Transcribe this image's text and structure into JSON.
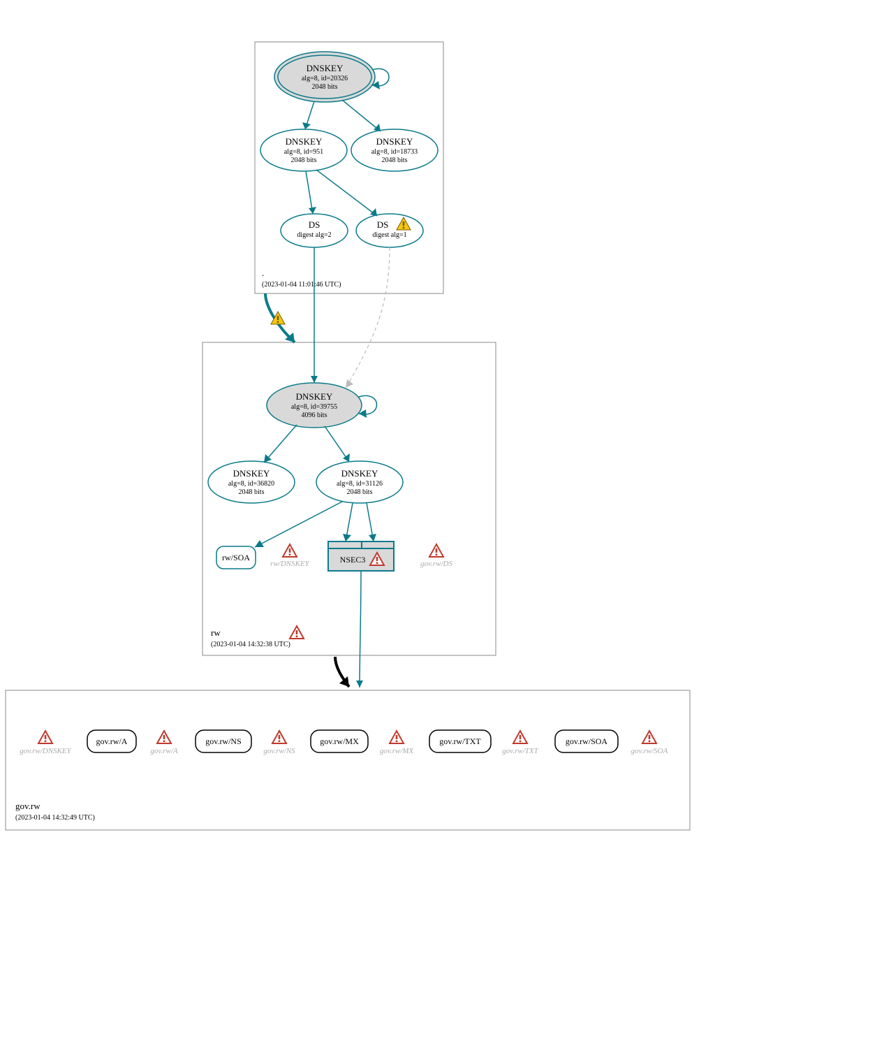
{
  "zones": {
    "root": {
      "label": ".",
      "timestamp": "(2023-01-04 11:01:46 UTC)",
      "nodes": {
        "ksk": {
          "title": "DNSKEY",
          "line2": "alg=8, id=20326",
          "line3": "2048 bits"
        },
        "zsk1": {
          "title": "DNSKEY",
          "line2": "alg=8, id=951",
          "line3": "2048 bits"
        },
        "zsk2": {
          "title": "DNSKEY",
          "line2": "alg=8, id=18733",
          "line3": "2048 bits"
        },
        "ds1": {
          "title": "DS",
          "line2": "digest alg=2"
        },
        "ds2": {
          "title": "DS",
          "line2": "digest alg=1"
        }
      }
    },
    "rw": {
      "label": "rw",
      "timestamp": "(2023-01-04 14:32:38 UTC)",
      "nodes": {
        "ksk": {
          "title": "DNSKEY",
          "line2": "alg=8, id=39755",
          "line3": "4096 bits"
        },
        "zskA": {
          "title": "DNSKEY",
          "line2": "alg=8, id=36820",
          "line3": "2048 bits"
        },
        "zskB": {
          "title": "DNSKEY",
          "line2": "alg=8, id=31126",
          "line3": "2048 bits"
        },
        "soa": {
          "label": "rw/SOA"
        },
        "nsec3": {
          "label": "NSEC3"
        },
        "ghost_dnskey": {
          "label": "rw/DNSKEY"
        },
        "ghost_ds": {
          "label": "gov.rw/DS"
        }
      }
    },
    "govrw": {
      "label": "gov.rw",
      "timestamp": "(2023-01-04 14:32:49 UTC)",
      "nodes": {
        "ghost_dnskey": {
          "label": "gov.rw/DNSKEY"
        },
        "a": {
          "label": "gov.rw/A"
        },
        "ghost_a": {
          "label": "gov.rw/A"
        },
        "ns": {
          "label": "gov.rw/NS"
        },
        "ghost_ns": {
          "label": "gov.rw/NS"
        },
        "mx": {
          "label": "gov.rw/MX"
        },
        "ghost_mx": {
          "label": "gov.rw/MX"
        },
        "txt": {
          "label": "gov.rw/TXT"
        },
        "ghost_txt": {
          "label": "gov.rw/TXT"
        },
        "soa": {
          "label": "gov.rw/SOA"
        },
        "ghost_soa": {
          "label": "gov.rw/SOA"
        }
      }
    }
  }
}
